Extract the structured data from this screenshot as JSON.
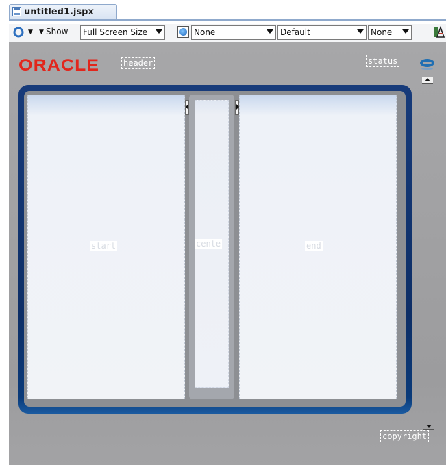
{
  "tab": {
    "title": "untitled1.jspx"
  },
  "toolbar": {
    "show_label": "Show",
    "screen_size": "Full Screen Size",
    "locale_select": "None",
    "skin_select": "Default",
    "last_select": "None"
  },
  "canvas": {
    "logo_text": "ORACLE",
    "facets": {
      "header": "header",
      "status": "status",
      "start": "start",
      "center": "cente",
      "end": "end",
      "copyright": "copyright"
    }
  },
  "colors": {
    "brand_red": "#e2261c",
    "frame_blue": "#0d2e66",
    "canvas_gray": "#a1a1a3"
  }
}
